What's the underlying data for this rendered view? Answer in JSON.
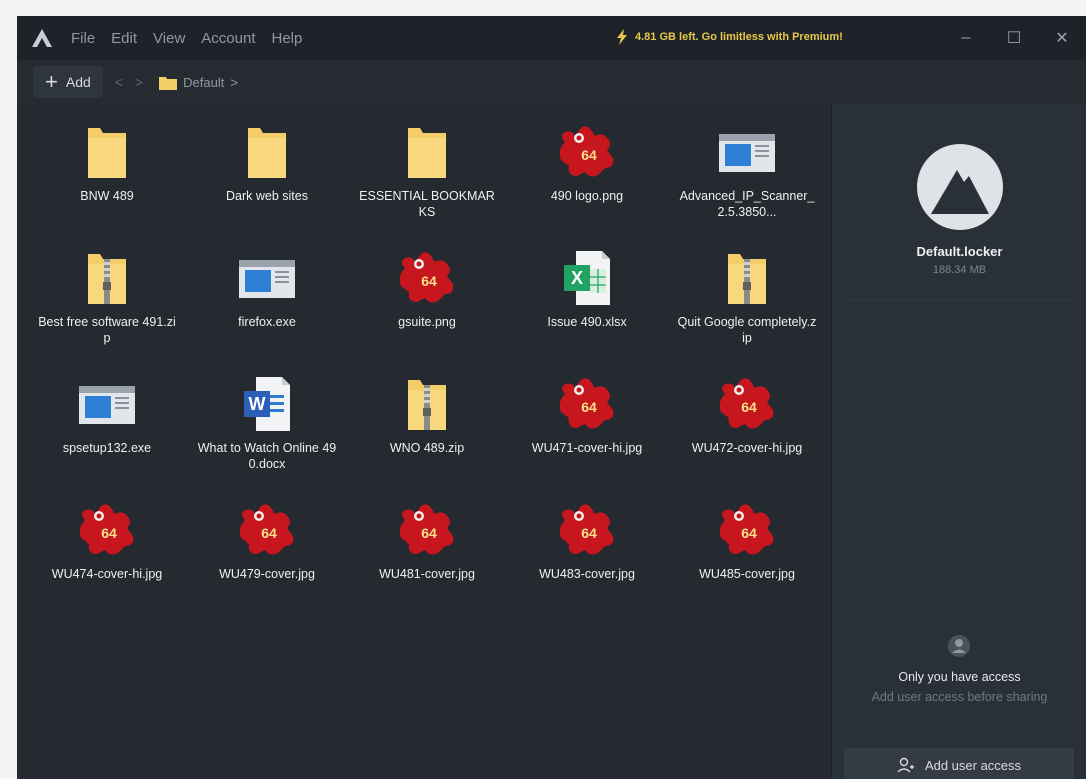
{
  "menu": [
    "File",
    "Edit",
    "View",
    "Account",
    "Help"
  ],
  "promo": {
    "text": "4.81 GB left. Go limitless with Premium!",
    "color": "#e5c84a"
  },
  "window_controls": {
    "minimize": "–",
    "maximize": "☐",
    "close": "✕"
  },
  "toolbar": {
    "add_label": "Add",
    "breadcrumb": "Default"
  },
  "files": [
    {
      "name": "BNW 489",
      "type": "folder"
    },
    {
      "name": "Dark web sites",
      "type": "folder"
    },
    {
      "name": "ESSENTIAL BOOKMARKS",
      "type": "folder"
    },
    {
      "name": "490 logo.png",
      "type": "image"
    },
    {
      "name": "Advanced_IP_Scanner_2.5.3850...",
      "type": "exe"
    },
    {
      "name": "Best free software 491.zip",
      "type": "zip"
    },
    {
      "name": "firefox.exe",
      "type": "exe"
    },
    {
      "name": "gsuite.png",
      "type": "image"
    },
    {
      "name": "Issue 490.xlsx",
      "type": "excel"
    },
    {
      "name": "Quit Google completely.zip",
      "type": "zip"
    },
    {
      "name": "spsetup132.exe",
      "type": "exe"
    },
    {
      "name": "What to Watch Online 490.docx",
      "type": "word"
    },
    {
      "name": "WNO 489.zip",
      "type": "zip"
    },
    {
      "name": "WU471-cover-hi.jpg",
      "type": "image"
    },
    {
      "name": "WU472-cover-hi.jpg",
      "type": "image"
    },
    {
      "name": "WU474-cover-hi.jpg",
      "type": "image"
    },
    {
      "name": "WU479-cover.jpg",
      "type": "image"
    },
    {
      "name": "WU481-cover.jpg",
      "type": "image"
    },
    {
      "name": "WU483-cover.jpg",
      "type": "image"
    },
    {
      "name": "WU485-cover.jpg",
      "type": "image"
    }
  ],
  "image_badge": "64",
  "excel_letter": "X",
  "word_letter": "W",
  "locker": {
    "name": "Default.locker",
    "size": "188.34 MB"
  },
  "access": {
    "title": "Only you have access",
    "subtitle": "Add user access before sharing",
    "button": "Add user access"
  },
  "colors": {
    "accent": "#e5c84a",
    "folder": "#f3cd68",
    "image_icon": "#c7161e"
  }
}
